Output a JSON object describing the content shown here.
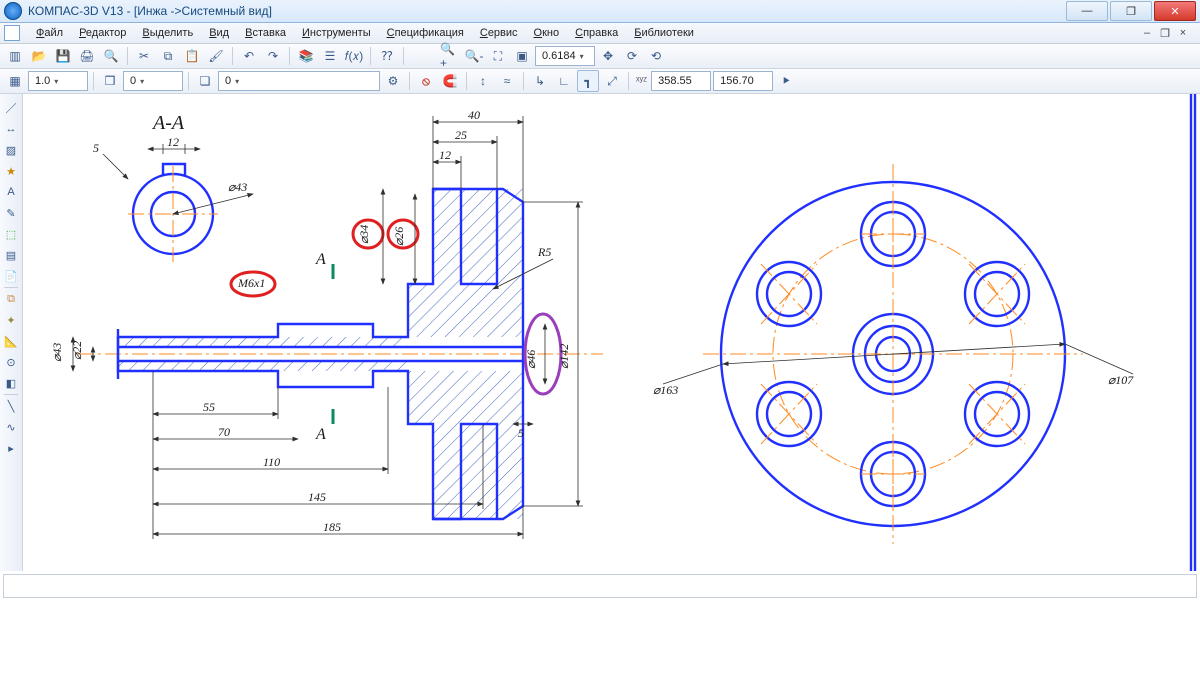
{
  "app": {
    "title_prefix": "КОМПАС-3D V13",
    "title_doc": " - [Инжа ->Системный вид]",
    "ghost_tab": ""
  },
  "menu": {
    "file": "Файл",
    "edit": "Редактор",
    "select": "Выделить",
    "view": "Вид",
    "insert": "Вставка",
    "tools": "Инструменты",
    "spec": "Спецификация",
    "service": "Сервис",
    "window": "Окно",
    "help": "Справка",
    "libs": "Библиотеки"
  },
  "toolbar1": {
    "zoom_value": "0.6184"
  },
  "toolbar2": {
    "step": "1.0",
    "layer": "0",
    "view": "0",
    "coord_x": "358.55",
    "coord_y": "156.70"
  },
  "drawing": {
    "section_title": "А-А",
    "cut_mark_top": "А",
    "cut_mark_bot": "А",
    "dims": {
      "d_detail_5": "5",
      "d_detail_12a": "12",
      "d_detail_phi43a": "⌀43",
      "d_top_40": "40",
      "d_top_25": "25",
      "d_top_12b": "12",
      "d_phi34": "⌀34",
      "d_phi26": "⌀26",
      "d_M6x1": "M6х1",
      "d_phi43b": "⌀43",
      "d_phi22": "⌀22",
      "d_phi46": "⌀46",
      "d_phi142": "⌀142",
      "d_R5": "R5",
      "d_5b": "5",
      "d_55": "55",
      "d_70": "70",
      "d_110": "110",
      "d_145": "145",
      "d_185": "185",
      "d_phi163": "⌀163",
      "d_phi107": "⌀107"
    }
  }
}
